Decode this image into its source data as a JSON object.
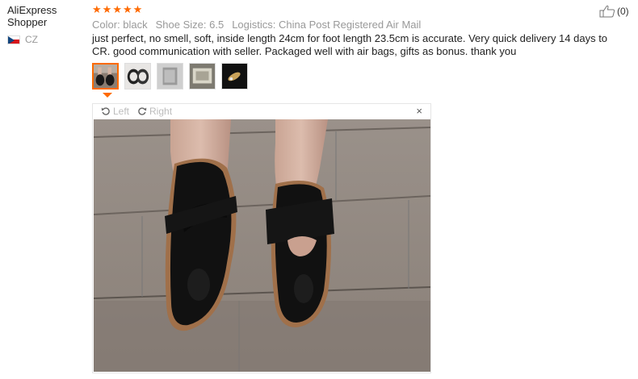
{
  "user": {
    "name_line1": "AliExpress",
    "name_line2": "Shopper",
    "country": "CZ"
  },
  "review": {
    "rating": 5,
    "stars": [
      "★",
      "★",
      "★",
      "★",
      "★"
    ],
    "color": "Color: black",
    "size": "Shoe Size: 6.5",
    "logistics": "Logistics: China Post Registered Air Mail",
    "text": "just perfect, no smell, soft, inside length 24cm for foot length 23.5cm is accurate. Very quick delivery 14 days to CR. good communication with seller. Packaged well with air bags, gifts as bonus. thank you"
  },
  "like": {
    "count": "(0)",
    "icon": "thumbs-up-icon"
  },
  "thumbnails": [
    "shoes-on-feet",
    "shoes-pair",
    "package",
    "bubble-wrap",
    "gift-item"
  ],
  "viewer": {
    "rotate_left": "Left",
    "rotate_right": "Right",
    "close": "×"
  },
  "colors": {
    "accent": "#ff6a00",
    "muted": "#999999"
  }
}
